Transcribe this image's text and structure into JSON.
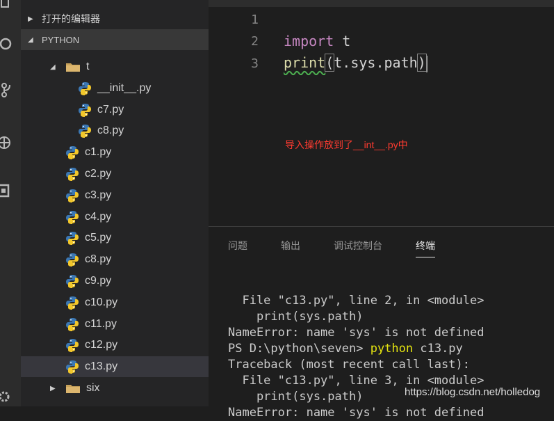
{
  "sidebar": {
    "open_editors_label": "打开的编辑器",
    "project_label": "PYTHON",
    "tree": [
      {
        "name": "t",
        "kind": "folder",
        "level": 1,
        "expanded": true
      },
      {
        "name": "__init__.py",
        "kind": "py",
        "level": 2
      },
      {
        "name": "c7.py",
        "kind": "py",
        "level": 2
      },
      {
        "name": "c8.py",
        "kind": "py",
        "level": 2
      },
      {
        "name": "c1.py",
        "kind": "py",
        "level": 1
      },
      {
        "name": "c2.py",
        "kind": "py",
        "level": 1
      },
      {
        "name": "c3.py",
        "kind": "py",
        "level": 1
      },
      {
        "name": "c4.py",
        "kind": "py",
        "level": 1
      },
      {
        "name": "c5.py",
        "kind": "py",
        "level": 1
      },
      {
        "name": "c8.py",
        "kind": "py",
        "level": 1
      },
      {
        "name": "c9.py",
        "kind": "py",
        "level": 1
      },
      {
        "name": "c10.py",
        "kind": "py",
        "level": 1
      },
      {
        "name": "c11.py",
        "kind": "py",
        "level": 1
      },
      {
        "name": "c12.py",
        "kind": "py",
        "level": 1
      },
      {
        "name": "c13.py",
        "kind": "py",
        "level": 1,
        "selected": true
      },
      {
        "name": "six",
        "kind": "folder",
        "level": 1,
        "expanded": false
      }
    ]
  },
  "editor": {
    "lines": [
      {
        "number": "1",
        "text": ""
      },
      {
        "number": "2",
        "keyword": "import",
        "rest": " t"
      },
      {
        "number": "3",
        "fn": "print",
        "open": "(",
        "arg": "t.sys.path",
        "close": ")"
      }
    ],
    "annotation": "导入操作放到了__int__.py中"
  },
  "panel": {
    "tabs": [
      "问题",
      "输出",
      "调试控制台",
      "终端"
    ],
    "active_tab": 3,
    "terminal": [
      "  File \"c13.py\", line 2, in <module>",
      "    print(sys.path)",
      "NameError: name 'sys' is not defined",
      {
        "prompt": "PS D:\\python\\seven> ",
        "cmd": "python",
        "arg": " c13.py"
      },
      "Traceback (most recent call last):",
      "  File \"c13.py\", line 3, in <module>",
      "    print(sys.path)",
      "NameError: name 'sys' is not defined"
    ]
  },
  "watermark": "https://blog.csdn.net/holledog",
  "colors": {
    "keyword": "#c586c0",
    "function": "#dcdcaa",
    "annotation": "#ff3b30",
    "terminal_command": "#e5e510"
  }
}
